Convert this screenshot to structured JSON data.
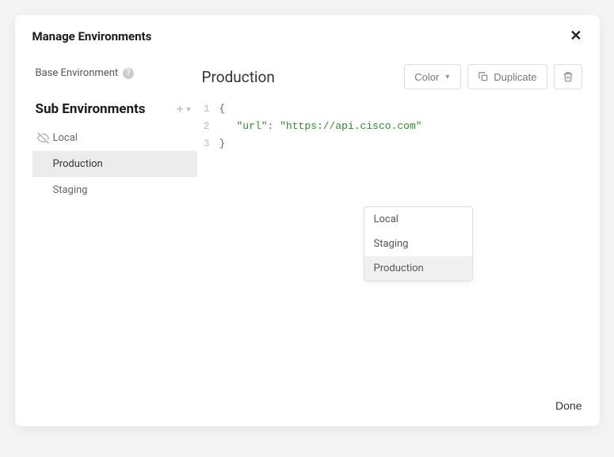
{
  "modal": {
    "title": "Manage Environments",
    "done_label": "Done"
  },
  "sidebar": {
    "base_env_label": "Base Environment",
    "sub_env_title": "Sub Environments",
    "items": [
      {
        "label": "Local",
        "hidden": true
      },
      {
        "label": "Production",
        "active": true
      },
      {
        "label": "Staging"
      }
    ]
  },
  "main": {
    "env_name": "Production",
    "toolbar": {
      "color_label": "Color",
      "duplicate_label": "Duplicate"
    },
    "editor": {
      "lines": [
        {
          "num": "1",
          "brace": "{"
        },
        {
          "num": "2",
          "key": "\"url\"",
          "colon": ":",
          "value": "\"https://api.cisco.com\""
        },
        {
          "num": "3",
          "brace": "}"
        }
      ]
    }
  },
  "dropdown": {
    "items": [
      {
        "label": "Local"
      },
      {
        "label": "Staging"
      },
      {
        "label": "Production",
        "selected": true
      }
    ]
  }
}
